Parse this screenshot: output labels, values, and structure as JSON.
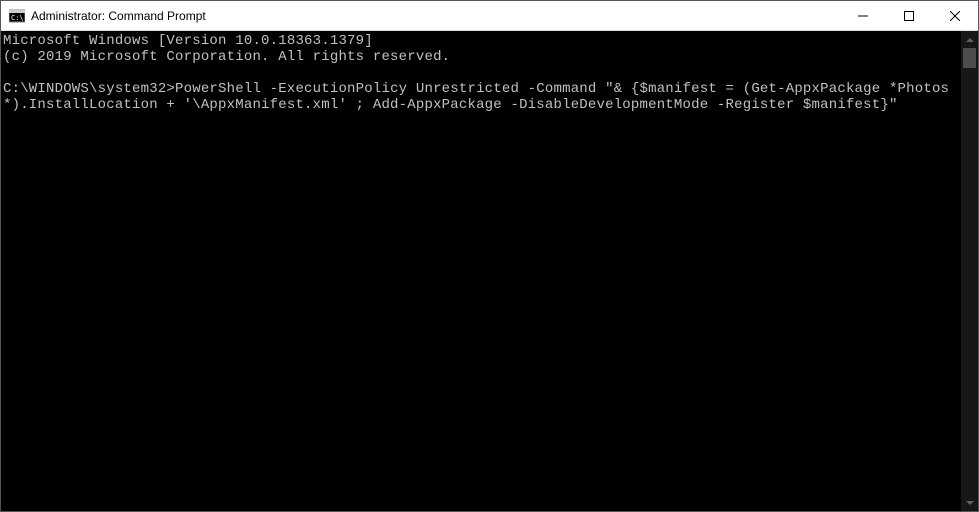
{
  "titlebar": {
    "title": "Administrator: Command Prompt"
  },
  "console": {
    "line1": "Microsoft Windows [Version 10.0.18363.1379]",
    "line2": "(c) 2019 Microsoft Corporation. All rights reserved.",
    "blank": "",
    "prompt": "C:\\WINDOWS\\system32>",
    "command": "PowerShell -ExecutionPolicy Unrestricted -Command \"& {$manifest = (Get-AppxPackage *Photos*).InstallLocation + '\\AppxManifest.xml' ; Add-AppxPackage -DisableDevelopmentMode -Register $manifest}\""
  }
}
